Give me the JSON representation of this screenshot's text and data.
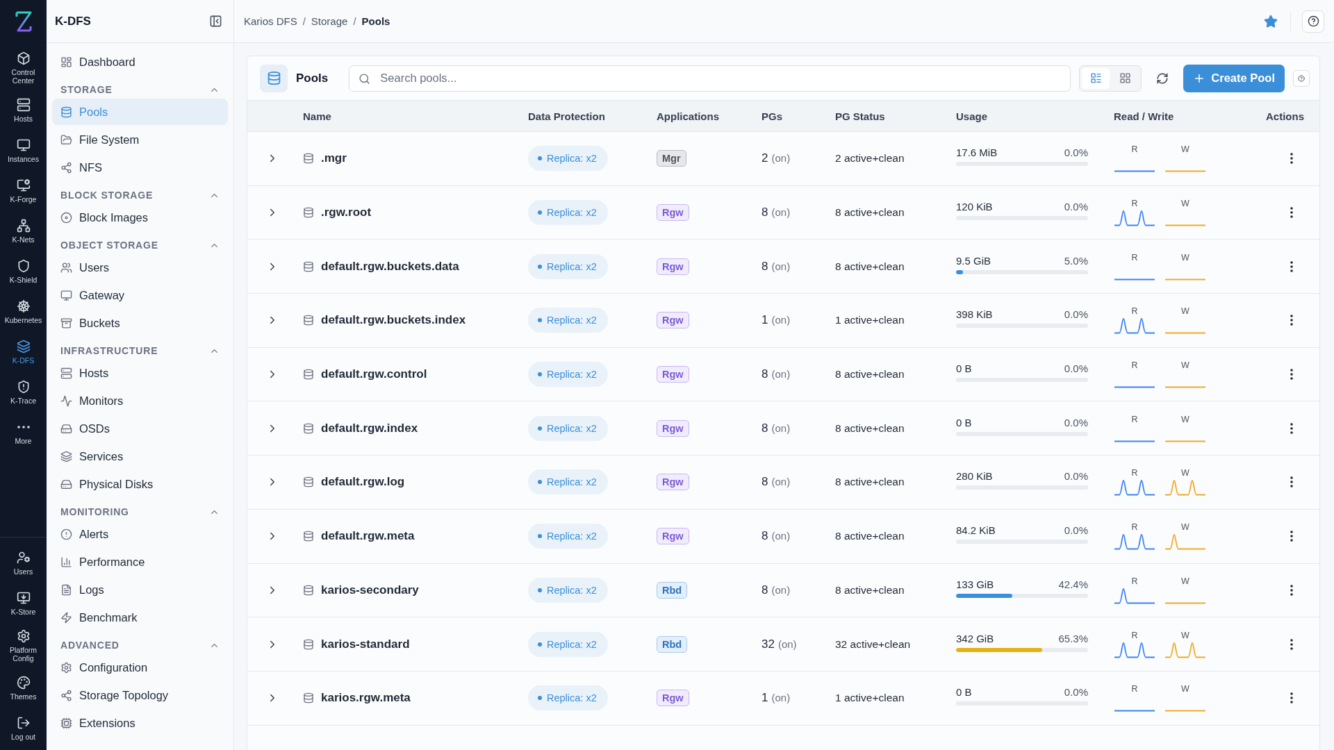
{
  "rail": {
    "items": [
      {
        "label": "Control Center",
        "selected": false
      },
      {
        "label": "Hosts",
        "selected": false
      },
      {
        "label": "Instances",
        "selected": false
      },
      {
        "label": "K-Forge",
        "selected": false
      },
      {
        "label": "K-Nets",
        "selected": false
      },
      {
        "label": "K-Shield",
        "selected": false
      },
      {
        "label": "Kubernetes",
        "selected": false
      },
      {
        "label": "K-DFS",
        "selected": true
      },
      {
        "label": "K-Trace",
        "selected": false
      },
      {
        "label": "More",
        "selected": false
      }
    ],
    "bottom_items": [
      {
        "label": "Users",
        "selected": false
      },
      {
        "label": "K-Store",
        "selected": false
      },
      {
        "label": "Platform Config",
        "selected": false
      },
      {
        "label": "Themes",
        "selected": false
      },
      {
        "label": "Log out",
        "selected": false
      }
    ]
  },
  "sidebar": {
    "title": "K-DFS",
    "items": [
      {
        "label": "Dashboard",
        "selected": false
      }
    ],
    "sections": [
      {
        "title": "STORAGE",
        "expanded": true,
        "items": [
          {
            "label": "Pools",
            "selected": true
          },
          {
            "label": "File System",
            "selected": false
          },
          {
            "label": "NFS",
            "selected": false
          }
        ]
      },
      {
        "title": "BLOCK STORAGE",
        "expanded": true,
        "items": [
          {
            "label": "Block Images",
            "selected": false
          }
        ]
      },
      {
        "title": "OBJECT STORAGE",
        "expanded": true,
        "items": [
          {
            "label": "Users",
            "selected": false
          },
          {
            "label": "Gateway",
            "selected": false
          },
          {
            "label": "Buckets",
            "selected": false
          }
        ]
      },
      {
        "title": "INFRASTRUCTURE",
        "expanded": true,
        "items": [
          {
            "label": "Hosts",
            "selected": false
          },
          {
            "label": "Monitors",
            "selected": false
          },
          {
            "label": "OSDs",
            "selected": false
          },
          {
            "label": "Services",
            "selected": false
          },
          {
            "label": "Physical Disks",
            "selected": false
          }
        ]
      },
      {
        "title": "MONITORING",
        "expanded": true,
        "items": [
          {
            "label": "Alerts",
            "selected": false
          },
          {
            "label": "Performance",
            "selected": false
          },
          {
            "label": "Logs",
            "selected": false
          },
          {
            "label": "Benchmark",
            "selected": false
          }
        ]
      },
      {
        "title": "ADVANCED",
        "expanded": true,
        "items": [
          {
            "label": "Configuration",
            "selected": false
          },
          {
            "label": "Storage Topology",
            "selected": false
          },
          {
            "label": "Extensions",
            "selected": false
          }
        ]
      }
    ]
  },
  "breadcrumb": [
    "Karios DFS",
    "Storage",
    "Pools"
  ],
  "breadcrumb_separator": "/",
  "favorite": {
    "on": true
  },
  "panel": {
    "title": "Pools",
    "search": {
      "placeholder": "Search pools..."
    },
    "view_modes": [
      {
        "kind": "list",
        "selected": true
      },
      {
        "kind": "grid",
        "selected": false
      }
    ],
    "create_button": "Create Pool"
  },
  "table": {
    "columns": [
      "Name",
      "Data Protection",
      "Applications",
      "PGs",
      "PG Status",
      "Usage",
      "Read / Write",
      "Actions"
    ],
    "rows": [
      {
        "expanded": false,
        "name": ".mgr",
        "protection": "Replica: x2",
        "application": {
          "label": "Mgr",
          "kind": "mgr"
        },
        "pgs": "2",
        "pgs_state": "(on)",
        "pg_status": "2 active+clean",
        "used": "17.6 MiB",
        "percent": "0.0%",
        "level": 0,
        "read": {
          "label": "R",
          "kind": "flat"
        },
        "write": {
          "label": "W",
          "kind": "flat"
        }
      },
      {
        "expanded": false,
        "name": ".rgw.root",
        "protection": "Replica: x2",
        "application": {
          "label": "Rgw",
          "kind": "rgw"
        },
        "pgs": "8",
        "pgs_state": "(on)",
        "pg_status": "8 active+clean",
        "used": "120 KiB",
        "percent": "0.0%",
        "level": 0,
        "read": {
          "label": "R",
          "kind": "double"
        },
        "write": {
          "label": "W",
          "kind": "flat"
        }
      },
      {
        "expanded": false,
        "name": "default.rgw.buckets.data",
        "protection": "Replica: x2",
        "application": {
          "label": "Rgw",
          "kind": "rgw"
        },
        "pgs": "8",
        "pgs_state": "(on)",
        "pg_status": "8 active+clean",
        "used": "9.5 GiB",
        "percent": "5.0%",
        "level": 0.05,
        "read": {
          "label": "R",
          "kind": "flat"
        },
        "write": {
          "label": "W",
          "kind": "flat"
        }
      },
      {
        "expanded": false,
        "name": "default.rgw.buckets.index",
        "protection": "Replica: x2",
        "application": {
          "label": "Rgw",
          "kind": "rgw"
        },
        "pgs": "1",
        "pgs_state": "(on)",
        "pg_status": "1 active+clean",
        "used": "398 KiB",
        "percent": "0.0%",
        "level": 0,
        "read": {
          "label": "R",
          "kind": "double"
        },
        "write": {
          "label": "W",
          "kind": "flat"
        }
      },
      {
        "expanded": false,
        "name": "default.rgw.control",
        "protection": "Replica: x2",
        "application": {
          "label": "Rgw",
          "kind": "rgw"
        },
        "pgs": "8",
        "pgs_state": "(on)",
        "pg_status": "8 active+clean",
        "used": "0 B",
        "percent": "0.0%",
        "level": 0,
        "read": {
          "label": "R",
          "kind": "flat"
        },
        "write": {
          "label": "W",
          "kind": "flat"
        }
      },
      {
        "expanded": false,
        "name": "default.rgw.index",
        "protection": "Replica: x2",
        "application": {
          "label": "Rgw",
          "kind": "rgw"
        },
        "pgs": "8",
        "pgs_state": "(on)",
        "pg_status": "8 active+clean",
        "used": "0 B",
        "percent": "0.0%",
        "level": 0,
        "read": {
          "label": "R",
          "kind": "flat"
        },
        "write": {
          "label": "W",
          "kind": "flat"
        }
      },
      {
        "expanded": false,
        "name": "default.rgw.log",
        "protection": "Replica: x2",
        "application": {
          "label": "Rgw",
          "kind": "rgw"
        },
        "pgs": "8",
        "pgs_state": "(on)",
        "pg_status": "8 active+clean",
        "used": "280 KiB",
        "percent": "0.0%",
        "level": 0,
        "read": {
          "label": "R",
          "kind": "double"
        },
        "write": {
          "label": "W",
          "kind": "double"
        }
      },
      {
        "expanded": false,
        "name": "default.rgw.meta",
        "protection": "Replica: x2",
        "application": {
          "label": "Rgw",
          "kind": "rgw"
        },
        "pgs": "8",
        "pgs_state": "(on)",
        "pg_status": "8 active+clean",
        "used": "84.2 KiB",
        "percent": "0.0%",
        "level": 0,
        "read": {
          "label": "R",
          "kind": "double"
        },
        "write": {
          "label": "W",
          "kind": "single"
        }
      },
      {
        "expanded": false,
        "name": "karios-secondary",
        "protection": "Replica: x2",
        "application": {
          "label": "Rbd",
          "kind": "rbd"
        },
        "pgs": "8",
        "pgs_state": "(on)",
        "pg_status": "8 active+clean",
        "used": "133 GiB",
        "percent": "42.4%",
        "level": 0.424,
        "read": {
          "label": "R",
          "kind": "single"
        },
        "write": {
          "label": "W",
          "kind": "flat"
        }
      },
      {
        "expanded": false,
        "name": "karios-standard",
        "protection": "Replica: x2",
        "application": {
          "label": "Rbd",
          "kind": "rbd"
        },
        "pgs": "32",
        "pgs_state": "(on)",
        "pg_status": "32 active+clean",
        "used": "342 GiB",
        "percent": "65.3%",
        "level": 0.653,
        "read": {
          "label": "R",
          "kind": "double"
        },
        "write": {
          "label": "W",
          "kind": "double"
        }
      },
      {
        "expanded": false,
        "name": "karios.rgw.meta",
        "protection": "Replica: x2",
        "application": {
          "label": "Rgw",
          "kind": "rgw"
        },
        "pgs": "1",
        "pgs_state": "(on)",
        "pg_status": "1 active+clean",
        "used": "0 B",
        "percent": "0.0%",
        "level": 0,
        "read": {
          "label": "R",
          "kind": "flat"
        },
        "write": {
          "label": "W",
          "kind": "flat"
        }
      }
    ]
  }
}
